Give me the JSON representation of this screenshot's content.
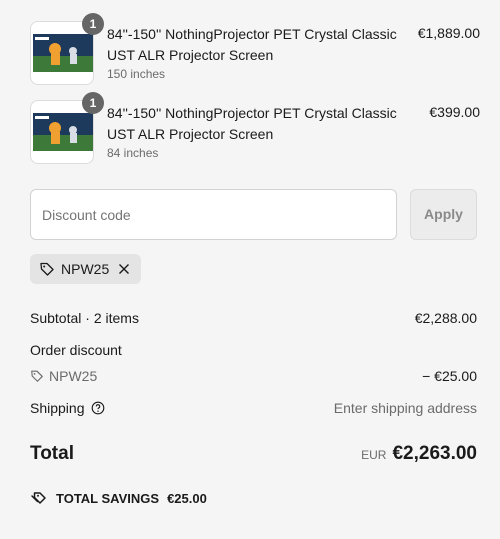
{
  "items": [
    {
      "quantity": "1",
      "title": "84''-150'' NothingProjector PET Crystal Classic UST ALR Projector Screen",
      "variant": "150 inches",
      "price": "€1,889.00"
    },
    {
      "quantity": "1",
      "title": "84''-150'' NothingProjector PET Crystal Classic UST ALR Projector Screen",
      "variant": "84 inches",
      "price": "€399.00"
    }
  ],
  "discount": {
    "placeholder": "Discount code",
    "apply_label": "Apply",
    "applied_code": "NPW25"
  },
  "summary": {
    "subtotal_label": "Subtotal · 2 items",
    "subtotal_value": "€2,288.00",
    "order_discount_label": "Order discount",
    "order_discount_code": "NPW25",
    "order_discount_value": "− €25.00",
    "shipping_label": "Shipping",
    "shipping_value": "Enter shipping address",
    "total_label": "Total",
    "total_currency": "EUR",
    "total_value": "€2,263.00",
    "savings_label": "TOTAL SAVINGS",
    "savings_value": "€25.00"
  },
  "icons": [
    "tag-icon",
    "close-icon",
    "help-icon",
    "savings-tags-icon"
  ],
  "colors": {
    "background": "#f5f5f5",
    "qty_badge": "#666666",
    "muted_text": "#6b6b6b"
  }
}
